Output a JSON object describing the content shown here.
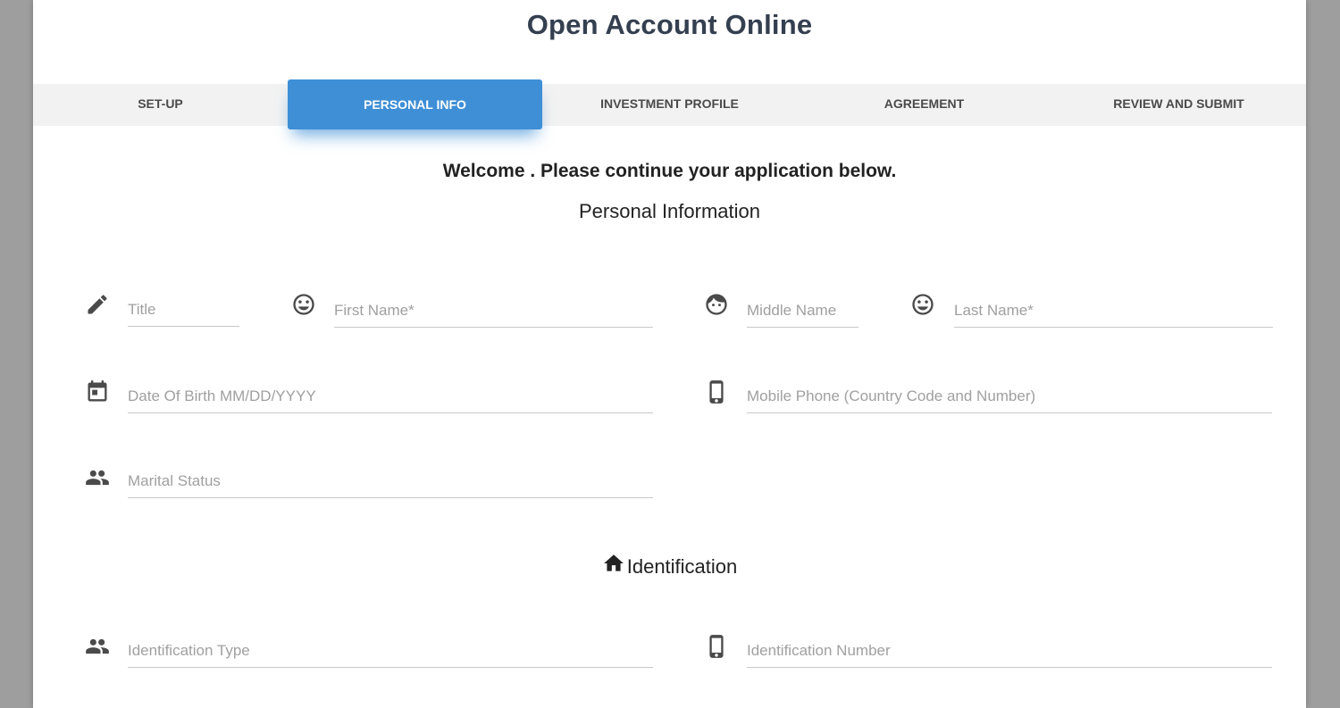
{
  "title": "Open Account Online",
  "steps": [
    {
      "label": "SET-UP"
    },
    {
      "label": "PERSONAL INFO"
    },
    {
      "label": "INVESTMENT PROFILE"
    },
    {
      "label": "AGREEMENT"
    },
    {
      "label": "REVIEW AND SUBMIT"
    }
  ],
  "active_step": "PERSONAL INFO",
  "welcome": "Welcome  . Please continue your application below.",
  "subtitle": "Personal Information",
  "fields": {
    "title": {
      "placeholder": "Title",
      "icon": "pencil-icon"
    },
    "first_name": {
      "placeholder": "First Name*",
      "icon": "smiley-icon"
    },
    "middle_name": {
      "placeholder": "Middle Name",
      "icon": "child-face-icon"
    },
    "last_name": {
      "placeholder": "Last Name*",
      "icon": "smiley-icon"
    },
    "dob": {
      "placeholder": "Date Of Birth MM/DD/YYYY",
      "icon": "calendar-icon"
    },
    "mobile": {
      "placeholder": "Mobile Phone (Country Code and Number)",
      "icon": "phone-icon"
    },
    "marital": {
      "placeholder": "Marital Status",
      "icon": "people-icon"
    },
    "id_type": {
      "placeholder": "Identification Type",
      "icon": "people-icon"
    },
    "id_number": {
      "placeholder": "Identification Number",
      "icon": "phone-icon"
    }
  },
  "identification_heading": "Identification",
  "colors": {
    "accent": "#3f8fd6",
    "title": "#343f50",
    "stepper_bg": "#f2f2f2",
    "icon": "#4a4a4a"
  }
}
